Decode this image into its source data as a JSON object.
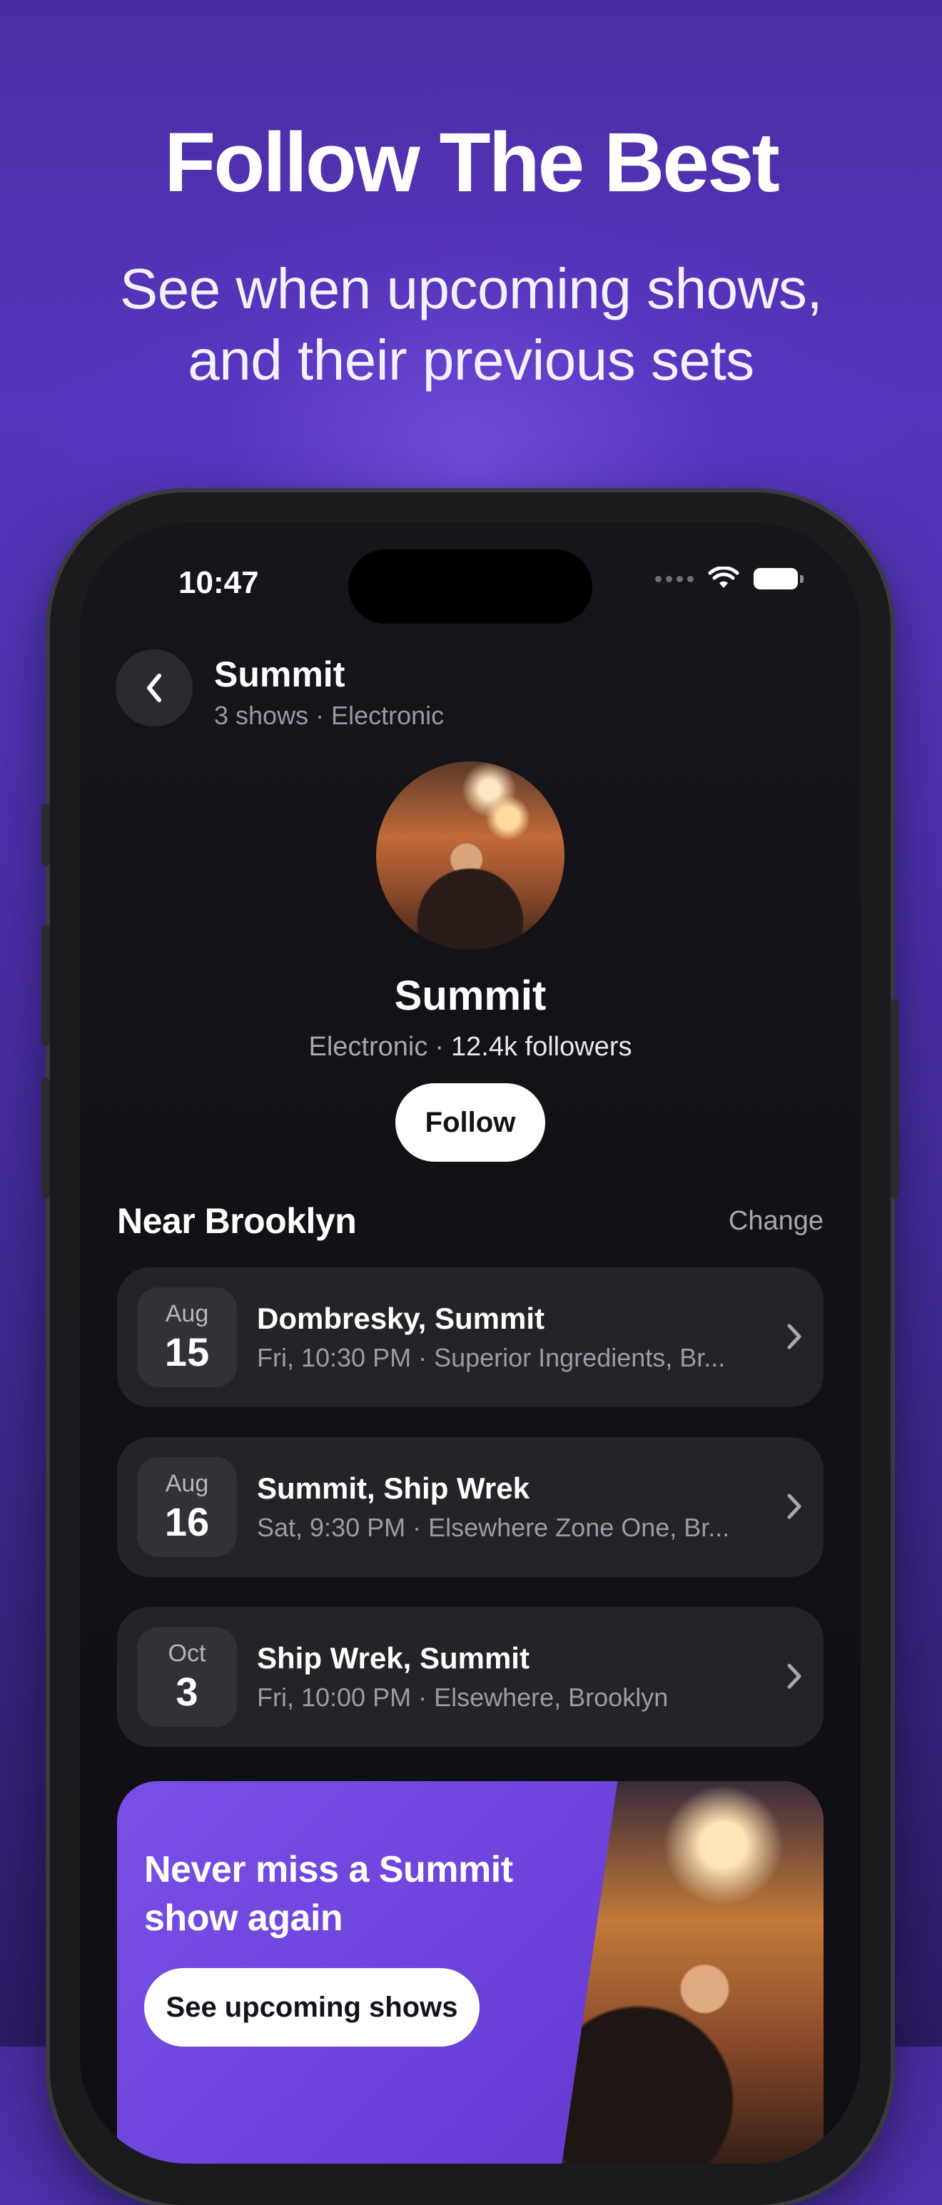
{
  "marketing": {
    "headline": "Follow The Best",
    "subhead_line1": "See when upcoming shows,",
    "subhead_line2": "and their previous sets"
  },
  "status_bar": {
    "time": "10:47"
  },
  "nav": {
    "title": "Summit",
    "subtitle": "3 shows · Electronic"
  },
  "artist": {
    "name": "Summit",
    "genre": "Electronic",
    "separator": "·",
    "followers": "12.4k followers",
    "follow_label": "Follow"
  },
  "section": {
    "title": "Near Brooklyn",
    "action": "Change"
  },
  "events": [
    {
      "month": "Aug",
      "day": "15",
      "title": "Dombresky, Summit",
      "subtitle": "Fri, 10:30 PM · Superior Ingredients, Br..."
    },
    {
      "month": "Aug",
      "day": "16",
      "title": "Summit, Ship Wrek",
      "subtitle": "Sat, 9:30 PM · Elsewhere Zone One, Br..."
    },
    {
      "month": "Oct",
      "day": "3",
      "title": "Ship Wrek, Summit",
      "subtitle": "Fri, 10:00 PM · Elsewhere, Brooklyn"
    }
  ],
  "promo": {
    "title_line1": "Never miss a Summit",
    "title_line2": "show again",
    "button_label": "See upcoming shows"
  },
  "colors": {
    "background": "#4a2da3",
    "screen": "#121116",
    "card": "#242328",
    "promo": "#7a4fe6"
  },
  "icons": [
    "back-chevron-icon",
    "wifi-icon",
    "battery-icon",
    "signal-icon",
    "chevron-right-icon"
  ]
}
